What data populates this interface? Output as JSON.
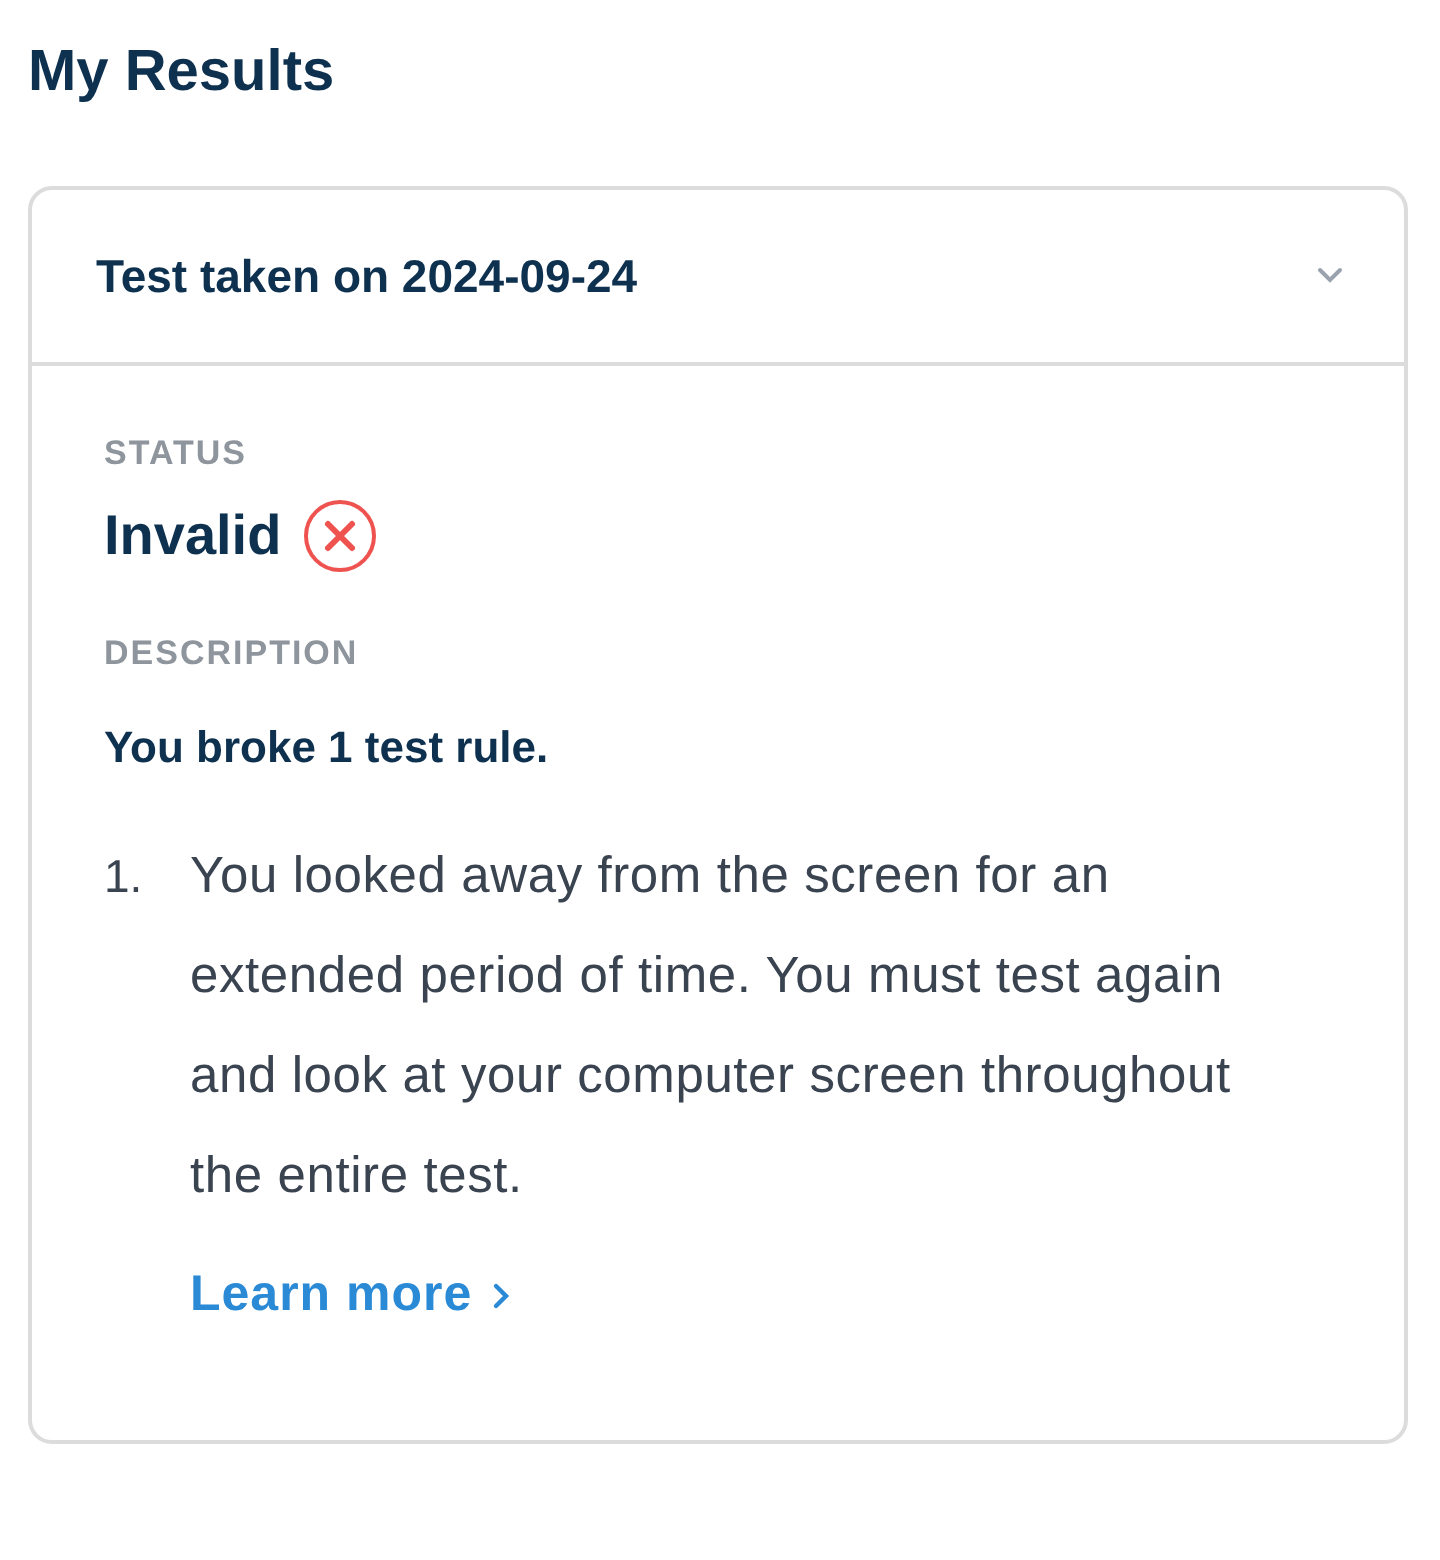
{
  "page_title": "My Results",
  "result": {
    "title": "Test taken on 2024-09-24",
    "expanded": true,
    "status_label": "STATUS",
    "status": {
      "text": "Invalid",
      "kind": "invalid"
    },
    "description_label": "DESCRIPTION",
    "summary": "You broke 1 test rule.",
    "rules": [
      {
        "number": "1.",
        "text": "You looked away from the screen for an extended period of time. You must test again and look at your computer screen throughout the entire test."
      }
    ],
    "link": "Learn more"
  }
}
